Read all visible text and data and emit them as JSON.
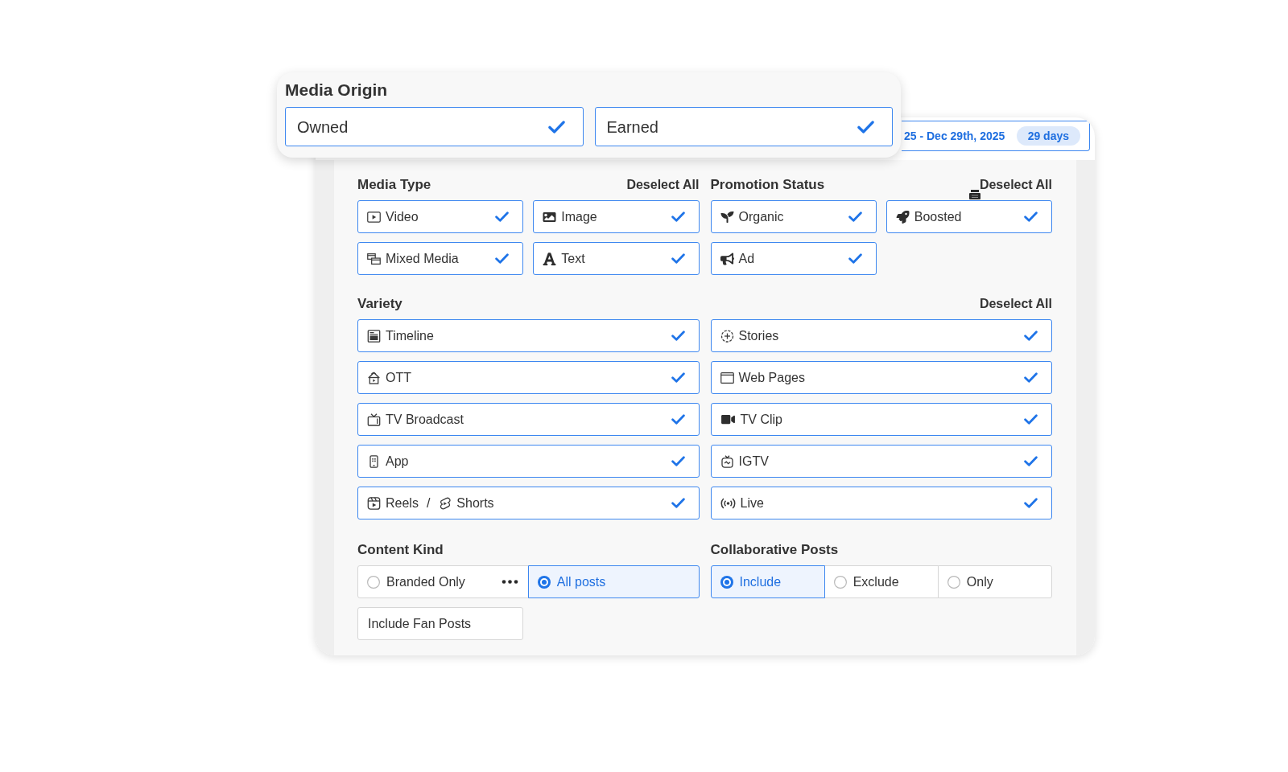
{
  "media_origin": {
    "title": "Media Origin",
    "options": [
      {
        "label": "Owned",
        "selected": true
      },
      {
        "label": "Earned",
        "selected": true
      }
    ]
  },
  "date_range": {
    "text": "25 - Dec 29th, 2025",
    "badge": "29 days"
  },
  "media_type": {
    "title": "Media Type",
    "action": "Deselect All",
    "options": [
      {
        "label": "Video",
        "selected": true
      },
      {
        "label": "Image",
        "selected": true
      },
      {
        "label": "Mixed Media",
        "selected": true
      },
      {
        "label": "Text",
        "selected": true
      }
    ]
  },
  "promotion_status": {
    "title": "Promotion Status",
    "action": "Deselect All",
    "options": [
      {
        "label": "Organic",
        "selected": true
      },
      {
        "label": "Boosted",
        "selected": true
      },
      {
        "label": "Ad",
        "selected": true
      }
    ]
  },
  "variety": {
    "title": "Variety",
    "action": "Deselect All",
    "options": [
      {
        "label": "Timeline",
        "selected": true
      },
      {
        "label": "Stories",
        "selected": true
      },
      {
        "label": "OTT",
        "selected": true
      },
      {
        "label": "Web Pages",
        "selected": true
      },
      {
        "label": "TV Broadcast",
        "selected": true
      },
      {
        "label": "TV Clip",
        "selected": true
      },
      {
        "label": "App",
        "selected": true
      },
      {
        "label": "IGTV",
        "selected": true
      },
      {
        "label": "Reels",
        "separator": "/",
        "second_label": "Shorts",
        "selected": true
      },
      {
        "label": "Live",
        "selected": true
      }
    ]
  },
  "content_kind": {
    "title": "Content Kind",
    "options": [
      {
        "label": "Branded Only",
        "selected": false
      },
      {
        "label": "All posts",
        "selected": true
      }
    ],
    "fan_posts": {
      "label": "Include Fan Posts",
      "selected": false
    }
  },
  "collaborative_posts": {
    "title": "Collaborative Posts",
    "options": [
      {
        "label": "Include",
        "selected": true
      },
      {
        "label": "Exclude",
        "selected": false
      },
      {
        "label": "Only",
        "selected": false
      }
    ]
  }
}
